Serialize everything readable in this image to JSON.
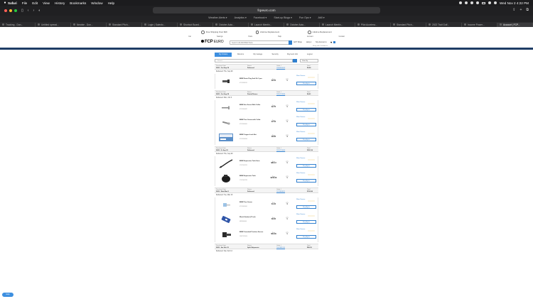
{
  "menubar": {
    "items": [
      "Safari",
      "File",
      "Edit",
      "View",
      "History",
      "Bookmarks",
      "Window",
      "Help"
    ],
    "clock": "Wed Nov 2  4:22 PM"
  },
  "toolbar": {
    "url": "fcpeuro.com"
  },
  "favorites": [
    "Weather Alerts ▾",
    "Analytics ▾",
    "Facebook ▾",
    "Start-up Blogs ▾",
    "Fun Ops ▾",
    "AMI ▾"
  ],
  "tabs": [
    "Tracking - Don...",
    "Untitled spread...",
    "Newbie - Don...",
    "Standard Pitch...",
    "Login | Salesfo...",
    "Shortcut Board...",
    "October Auto...",
    "Launch Meetin...",
    "October Auto...",
    "Launch Meetin...",
    "Pilot Accelera...",
    "Standard Pitch...",
    "2022 Trail Golf...",
    "Income Power...",
    "Account | FCP..."
  ],
  "site": {
    "promo": [
      "Free Shipping Over $49",
      "Lifetime Replacement",
      "Lifetime Replacement"
    ],
    "topnav": [
      "Car",
      "Savings",
      "Parts",
      "Help",
      "Account",
      "Contact"
    ],
    "logo_main": "FCP",
    "logo_sub": "EURO",
    "search_placeholder": "Search 120,000 BMW Parts",
    "links": [
      "GFT Shop",
      "Help ▾",
      "My Account ▾"
    ],
    "small": "Shop with Confidence"
  },
  "account": {
    "tabs": [
      "My Orders",
      "Returns",
      "My Garage",
      "Security",
      "Payment Info",
      "Logout"
    ],
    "search_placeholder": "Search",
    "filter": "Filter By"
  },
  "labels": {
    "purchase_date": "Purchase Date",
    "status": "Status",
    "order_no": "Order #",
    "total": "Total",
    "price": "Price",
    "qty": "QTY",
    "write_review": "Write Review",
    "buy_again": "Buy Again"
  },
  "orders": [
    {
      "summary": {
        "date": "2022 - Oct Sep 30",
        "status": "Delivered",
        "order": "7834900003",
        "total": "$4.26"
      },
      "delivered": "Delivered: Thu, Sep 29",
      "items": [
        {
          "name": "BMW Drain Plug Seal Kit 3 pcs",
          "part": "07119963151",
          "price": "$3.44",
          "qty": "1",
          "thumb": "bolt"
        }
      ]
    },
    {
      "summary": {
        "date": "2022 - Oct Sep 29",
        "status": "Partial Return",
        "order": "7815773924",
        "total": "$4.01"
      },
      "delivered": "Delivered: Mon, Oct 3",
      "items": [
        {
          "name": "BMW Hex Screw With Collar",
          "part": "07119904437",
          "price": "$2.76",
          "qty": "1",
          "thumb": "screw"
        },
        {
          "name": "BMW Torx Screw with Collar",
          "part": "07119904401",
          "price": "$7.53",
          "qty": "1",
          "thumb": "screw2"
        },
        {
          "name": "BMW Copper Lock Nut",
          "part": "07129904300",
          "price": "$6.83",
          "qty": "4",
          "thumb": "box"
        }
      ]
    },
    {
      "summary": {
        "date": "2022 - Fr Sep 23",
        "status": "Delivered",
        "order": "7813770843",
        "total": "$391.36"
      },
      "delivered": "Delivered: Thu, Sep 29",
      "items": [
        {
          "name": "BMW Expansion Tank Hose",
          "part": "17127547221",
          "price": "$83.13",
          "qty": "1",
          "thumb": "hose"
        },
        {
          "name": "BMW Expansion Tank",
          "part": "17137647235",
          "price": "$156.09",
          "qty": "1",
          "thumb": "tank"
        }
      ]
    },
    {
      "summary": {
        "date": "2022 - Wed Mar 8",
        "status": "Delivered",
        "order": "7673803811",
        "total": "$310.86"
      },
      "delivered": "Delivered: Tue, Mar 16",
      "items": [
        {
          "name": "BMW Torx Screw",
          "part": "07119905401",
          "price": "$1.34",
          "qty": "4",
          "thumb": "clip"
        },
        {
          "name": "Wurth Sealant (70 ml)",
          "part": "0893060006",
          "price": "$6.06",
          "qty": "1",
          "thumb": "tube"
        },
        {
          "name": "BMW Camshaft Position Sensor",
          "part": "13627525014",
          "price": "$52.99",
          "qty": "1",
          "thumb": "sensor"
        }
      ]
    },
    {
      "summary": {
        "date": "2022 - Sat Feb 12",
        "status": "Split Shipments",
        "order": "7647891120",
        "total": "$80.53"
      },
      "delivered": "Delivered: Sat, Feb 12",
      "items": []
    }
  ],
  "help_button": "Help",
  "colors": {
    "accent": "#3d8fe0",
    "stars": "#e6a817",
    "navy": "#1f3d66"
  }
}
